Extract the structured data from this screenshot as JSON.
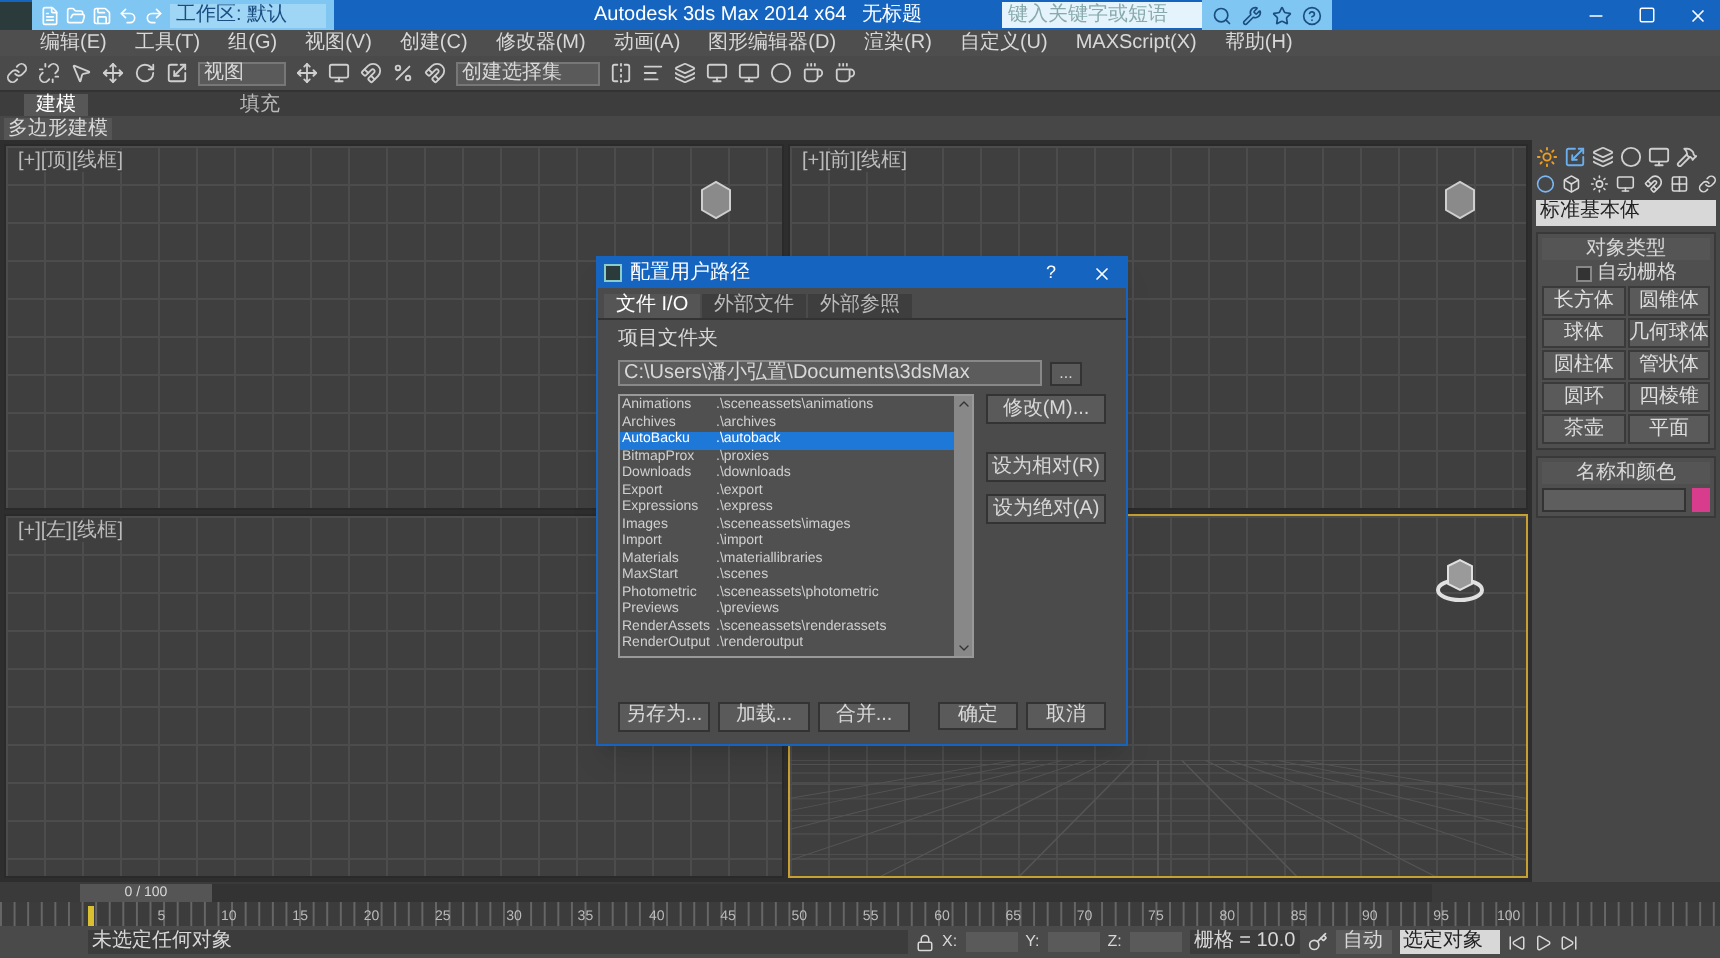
{
  "title_bar": {
    "workspace": "工作区: 默认",
    "title": "Autodesk 3ds Max  2014 x64",
    "document": "无标题",
    "search": {
      "placeholder": "键入关键字或短语"
    }
  },
  "menu": [
    "编辑(E)",
    "工具(T)",
    "组(G)",
    "视图(V)",
    "创建(C)",
    "修改器(M)",
    "动画(A)",
    "图形编辑器(D)",
    "渲染(R)",
    "自定义(U)",
    "MAXScript(X)",
    "帮助(H)"
  ],
  "toolbar": {
    "view_dropdown": "视图",
    "selection_set": "创建选择集"
  },
  "ribbon": {
    "tabs": [
      {
        "label": "建模",
        "selected": true
      },
      {
        "label": "填充",
        "selected": false
      }
    ],
    "panel": "多边形建模"
  },
  "viewports": [
    {
      "kind": "ortho",
      "label": "[+][顶][线框]",
      "active": false
    },
    {
      "kind": "ortho",
      "label": "[+][前][线框]",
      "active": false
    },
    {
      "kind": "ortho",
      "label": "[+][左][线框]",
      "active": false
    },
    {
      "kind": "perspective",
      "active": true
    }
  ],
  "command_panel": {
    "dropdown": "标准基本体",
    "object_type": {
      "title": "对象类型",
      "autogrid": {
        "label": "自动栅格",
        "checked": false
      },
      "buttons": [
        "长方体",
        "圆锥体",
        "球体",
        "几何球体",
        "圆柱体",
        "管状体",
        "圆环",
        "四棱锥",
        "茶壶",
        "平面"
      ]
    },
    "name_color": {
      "title": "名称和颜色",
      "color": "#d83c8c"
    }
  },
  "dialog": {
    "title": "配置用户路径",
    "help": "?",
    "tabs": [
      {
        "label": "文件 I/O",
        "selected": true
      },
      {
        "label": "外部文件",
        "selected": false
      },
      {
        "label": "外部参照",
        "selected": false
      }
    ],
    "folder_label": "项目文件夹",
    "folder_path": "C:\\Users\\潘小弘置\\Documents\\3dsMax",
    "browse": "...",
    "paths": [
      {
        "name": "Animations",
        "path": ".\\sceneassets\\animations",
        "selected": false
      },
      {
        "name": "Archives",
        "path": ".\\archives",
        "selected": false
      },
      {
        "name": "AutoBacku",
        "path": ".\\autoback",
        "selected": true
      },
      {
        "name": "BitmapProx",
        "path": ".\\proxies",
        "selected": false
      },
      {
        "name": "Downloads",
        "path": ".\\downloads",
        "selected": false
      },
      {
        "name": "Export",
        "path": ".\\export",
        "selected": false
      },
      {
        "name": "Expressions",
        "path": ".\\express",
        "selected": false
      },
      {
        "name": "Images",
        "path": ".\\sceneassets\\images",
        "selected": false
      },
      {
        "name": "Import",
        "path": ".\\import",
        "selected": false
      },
      {
        "name": "Materials",
        "path": ".\\materiallibraries",
        "selected": false
      },
      {
        "name": "MaxStart",
        "path": ".\\scenes",
        "selected": false
      },
      {
        "name": "Photometric",
        "path": ".\\sceneassets\\photometric",
        "selected": false
      },
      {
        "name": "Previews",
        "path": ".\\previews",
        "selected": false
      },
      {
        "name": "RenderAssets",
        "path": ".\\sceneassets\\renderassets",
        "selected": false
      },
      {
        "name": "RenderOutput",
        "path": ".\\renderoutput",
        "selected": false
      }
    ],
    "side_buttons": [
      "修改(M)...",
      "设为相对(R)",
      "设为绝对(A)"
    ],
    "bottom_buttons": [
      "另存为...",
      "加载...",
      "合并..."
    ],
    "ok": "确定",
    "cancel": "取消"
  },
  "timeline": {
    "position": "0 / 100",
    "level": 0,
    "ticks": [
      "5",
      "10",
      "15",
      "20",
      "25",
      "30",
      "35",
      "40",
      "45",
      "50",
      "55",
      "60",
      "65",
      "70",
      "75",
      "80",
      "85",
      "90",
      "95",
      "100"
    ]
  },
  "status": {
    "message": "未选定任何对象",
    "x_label": "X:",
    "y_label": "Y:",
    "z_label": "Z:",
    "grid": "栅格 = 10.0",
    "auto_key": "自动",
    "key_filter": "选定对象"
  }
}
